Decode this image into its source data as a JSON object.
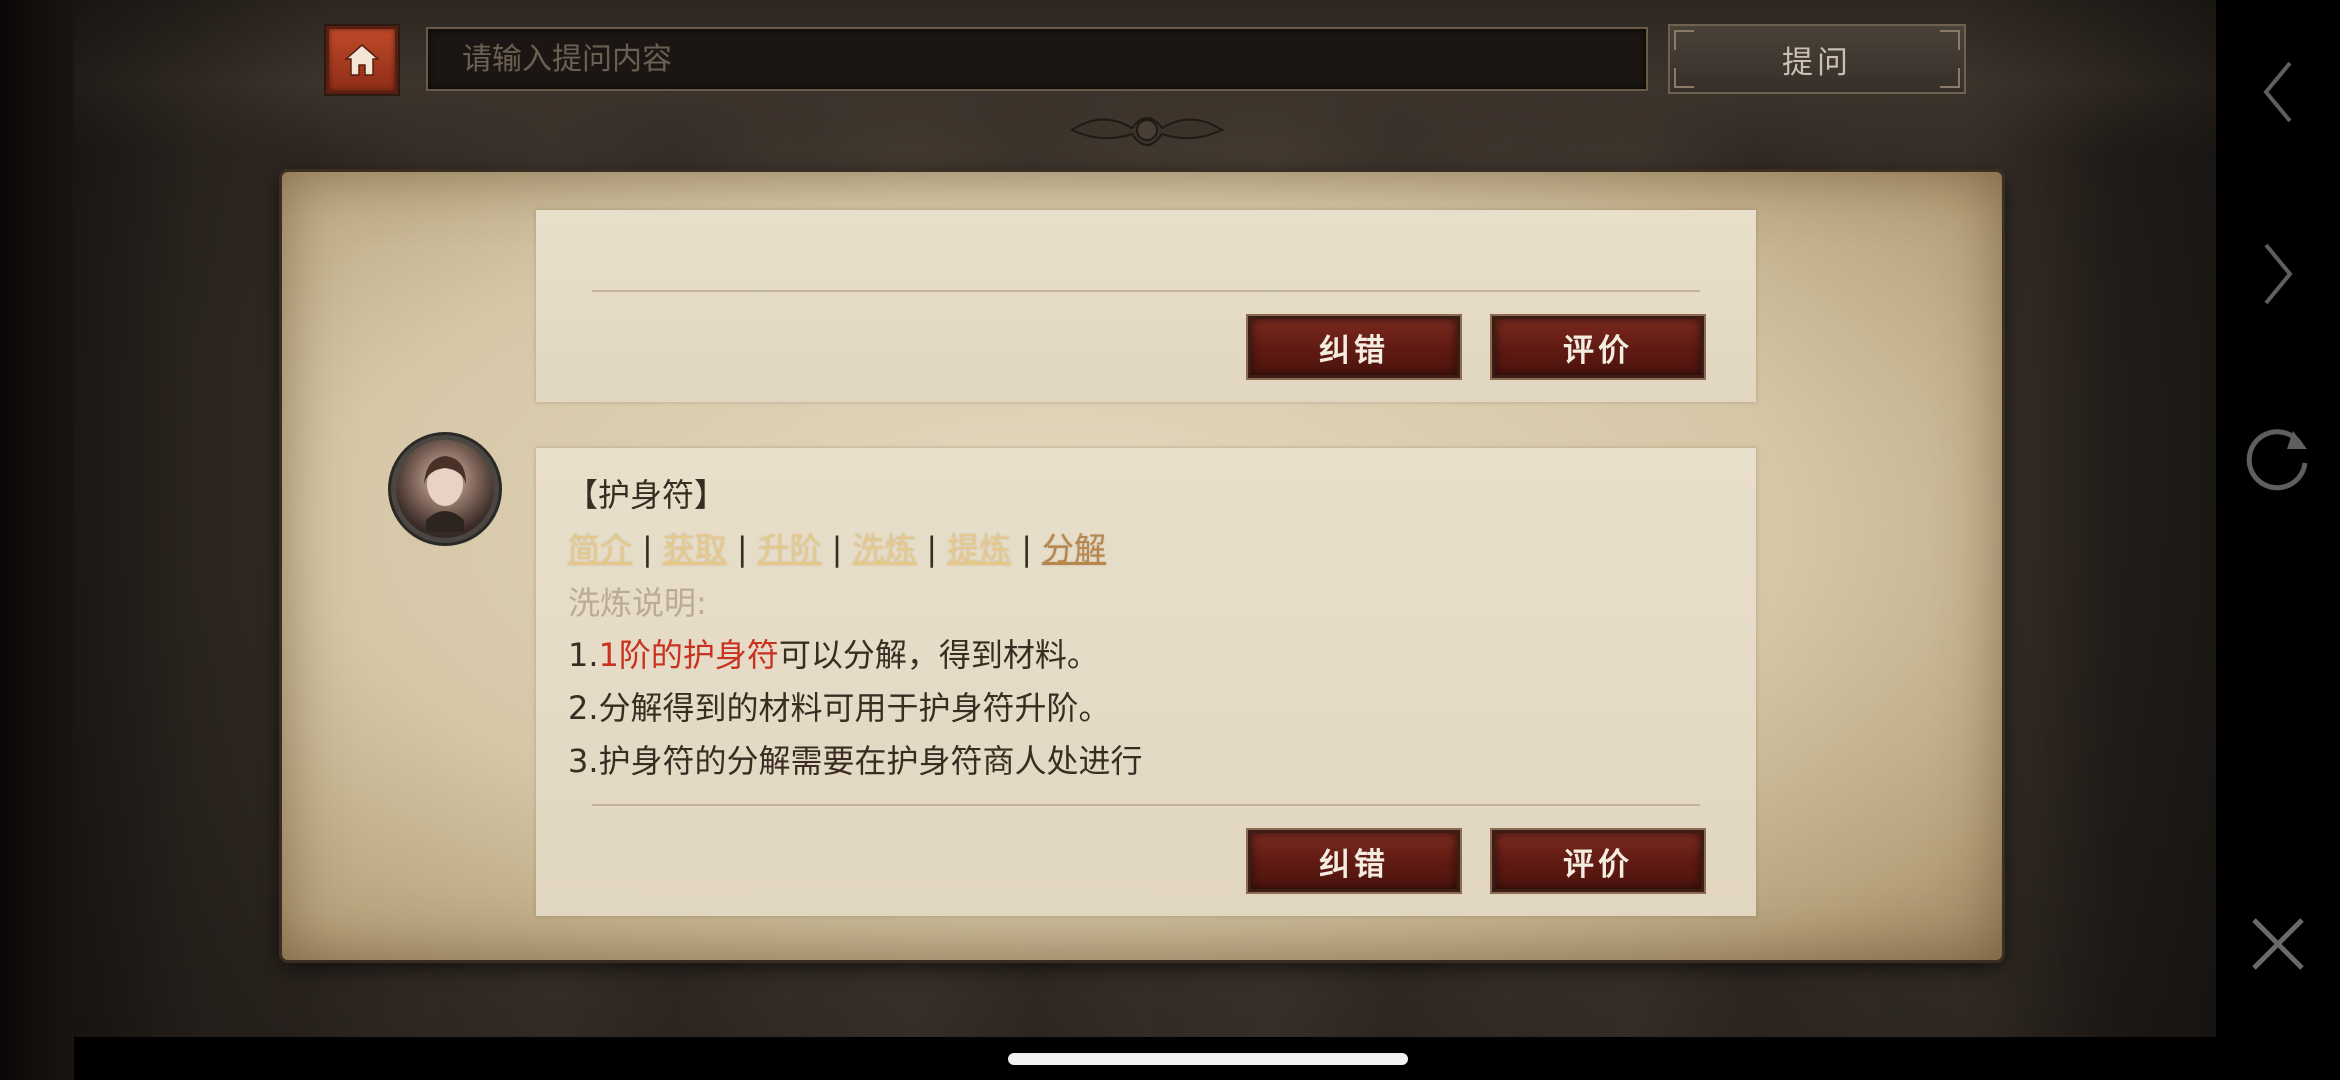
{
  "search": {
    "placeholder": "请输入提问内容",
    "ask_label": "提问"
  },
  "cards": [
    {
      "buttons": {
        "correct_label": "纠错",
        "rate_label": "评价"
      }
    },
    {
      "title": "【护身符】",
      "links": [
        "简介",
        "获取",
        "升阶",
        "洗炼",
        "提炼",
        "分解"
      ],
      "link_separator": "|",
      "section_label": "洗炼说明:",
      "line1_prefix": "1.",
      "line1_highlight": "1阶的护身符",
      "line1_rest": "可以分解，得到材料。",
      "line2": "2.分解得到的材料可用于护身符升阶。",
      "line3": "3.护身符的分解需要在护身符商人处进行",
      "buttons": {
        "correct_label": "纠错",
        "rate_label": "评价"
      }
    }
  ],
  "icons": {
    "home": "home-icon",
    "back": "chevron-left-icon",
    "forward": "chevron-right-icon",
    "reload": "reload-icon",
    "close": "close-icon"
  },
  "colors": {
    "home_button": "#b03e22",
    "action_button": "#6a2218",
    "link": "#e6c98a",
    "active_link": "#b8854a",
    "highlight": "#c8321e"
  }
}
